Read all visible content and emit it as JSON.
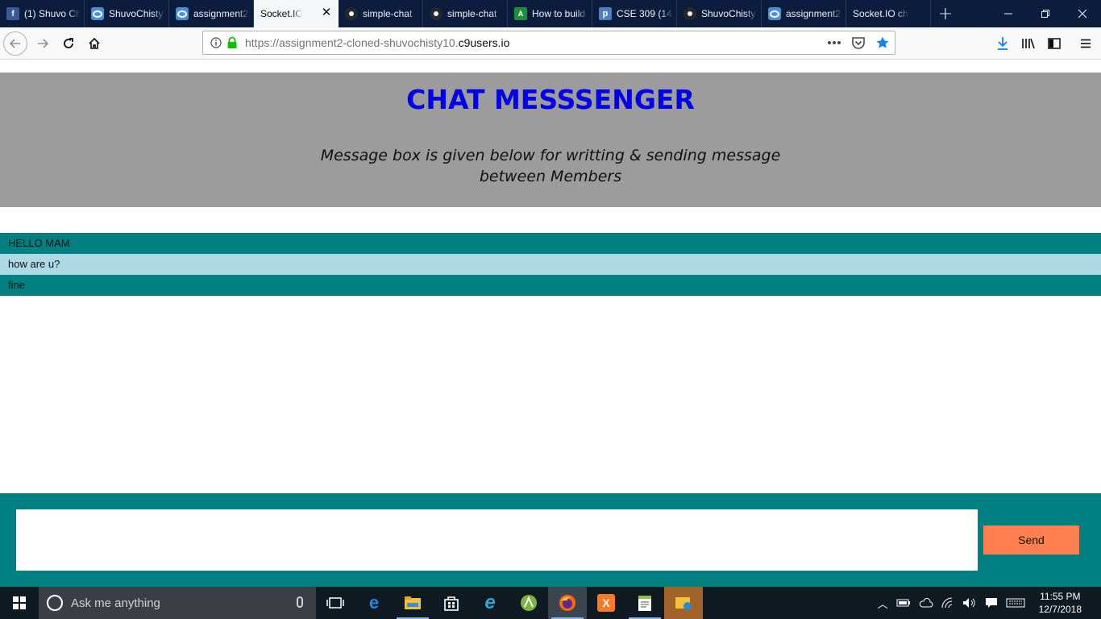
{
  "browser": {
    "tabs": [
      {
        "label": "(1) Shuvo Chisty",
        "favicon": "facebook-icon",
        "active": false
      },
      {
        "label": "ShuvoChisty",
        "favicon": "cloud9-icon",
        "active": false
      },
      {
        "label": "assignment2",
        "favicon": "cloud9-icon",
        "active": false
      },
      {
        "label": "Socket.IO chat",
        "favicon": "none",
        "active": true
      },
      {
        "label": "simple-chat",
        "favicon": "github-icon",
        "active": false
      },
      {
        "label": "simple-chat",
        "favicon": "github-icon",
        "active": false
      },
      {
        "label": "How to build",
        "favicon": "android-studio-icon",
        "active": false
      },
      {
        "label": "CSE 309 (14",
        "favicon": "piazza-icon",
        "active": false
      },
      {
        "label": "ShuvoChisty",
        "favicon": "github-icon",
        "active": false
      },
      {
        "label": "assignment2",
        "favicon": "cloud9-icon",
        "active": false
      },
      {
        "label": "Socket.IO chat",
        "favicon": "none",
        "active": false
      }
    ],
    "url_prefix": "https://assignment2-cloned-shuvochisty10.",
    "url_host": "c9users.io"
  },
  "page": {
    "title": "CHAT MESSSENGER",
    "subtitle": "Message box is given below for writting & sending message between Members",
    "messages": [
      {
        "text": "HELLO MAM",
        "style": "teal"
      },
      {
        "text": "how are u?",
        "style": "light"
      },
      {
        "text": "fine",
        "style": "teal"
      }
    ],
    "composer": {
      "input_value": "",
      "send_label": "Send"
    },
    "colors": {
      "header_bg": "#9c9c9c",
      "title": "#0000ee",
      "teal": "#008080",
      "light_blue": "#add8e6",
      "send_button": "#ff7f50"
    }
  },
  "taskbar": {
    "search_placeholder": "Ask me anything",
    "time": "11:55 PM",
    "date": "12/7/2018"
  }
}
